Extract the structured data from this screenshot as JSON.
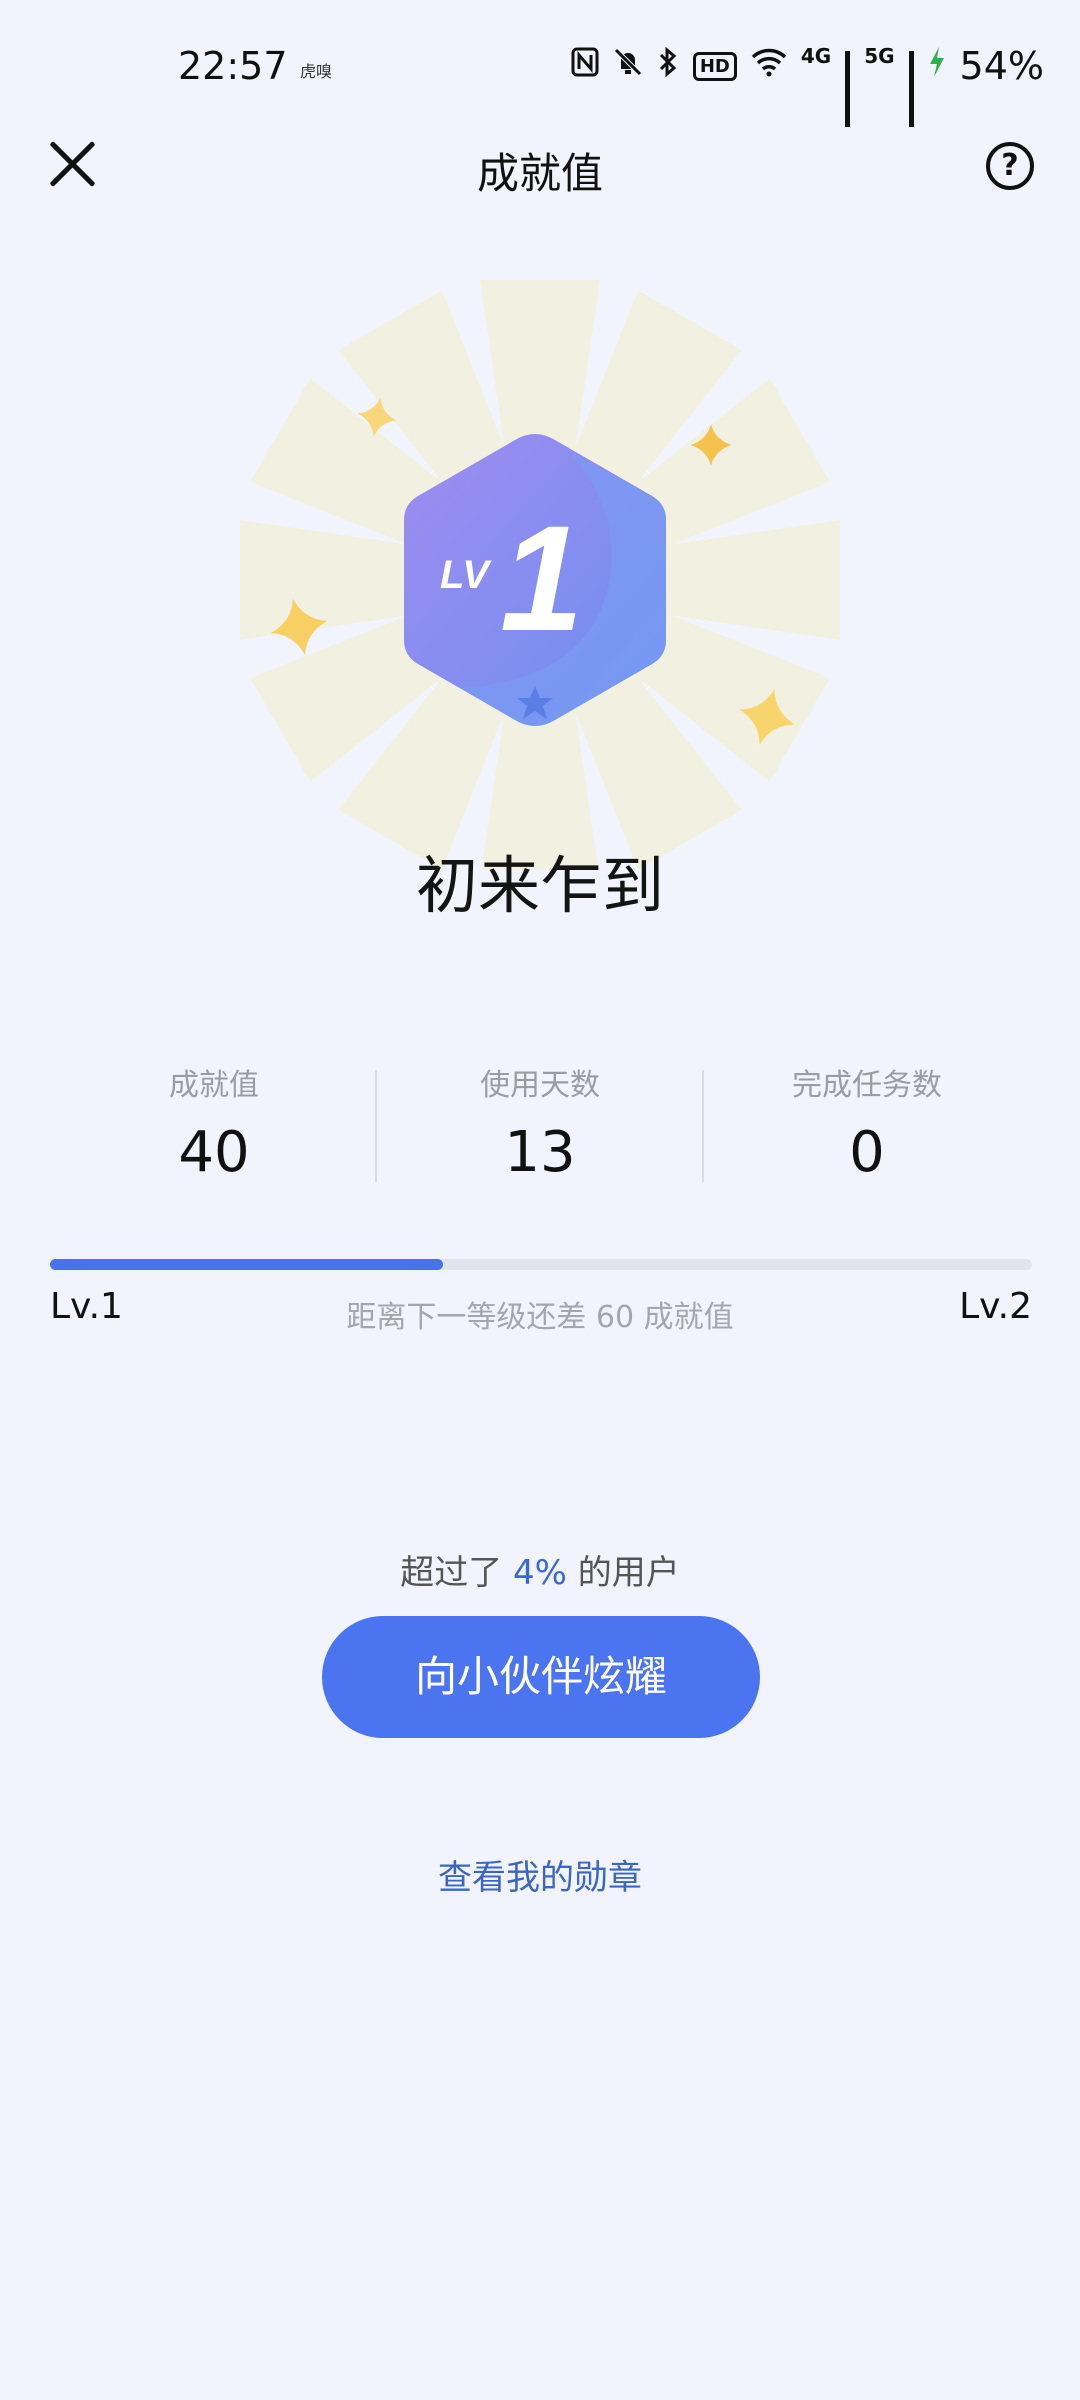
{
  "status_bar": {
    "time": "22:57",
    "app_indicator": "虎嗅",
    "icons": [
      "nfc-icon",
      "mute-icon",
      "bluetooth-icon",
      "hd-icon",
      "wifi-icon",
      "signal-4g-icon",
      "signal-5g-icon",
      "charging-icon"
    ],
    "hd_label": "HD",
    "net_4g": "4G",
    "net_5g": "5G",
    "battery": "54%"
  },
  "header": {
    "title": "成就值",
    "close_icon": "close-icon",
    "help_icon": "help-icon",
    "help_glyph": "?"
  },
  "badge": {
    "level_prefix": "LV",
    "level_number": "1",
    "title": "初来乍到",
    "colors": {
      "hex_light": "#a08cf0",
      "hex_dark": "#6f8ff0",
      "star": "#f7cf62"
    }
  },
  "stats": [
    {
      "label": "成就值",
      "value": "40"
    },
    {
      "label": "使用天数",
      "value": "13"
    },
    {
      "label": "完成任务数",
      "value": "0"
    }
  ],
  "progress": {
    "current_level": "Lv.1",
    "next_level": "Lv.2",
    "fraction": 0.4,
    "text": "距离下一等级还差 60 成就值"
  },
  "beat": {
    "prefix": "超过了",
    "percent": "4%",
    "suffix": "的用户"
  },
  "share_button": "向小伙伴炫耀",
  "medal_link": "查看我的勋章",
  "accent_color": "#4a74f0"
}
